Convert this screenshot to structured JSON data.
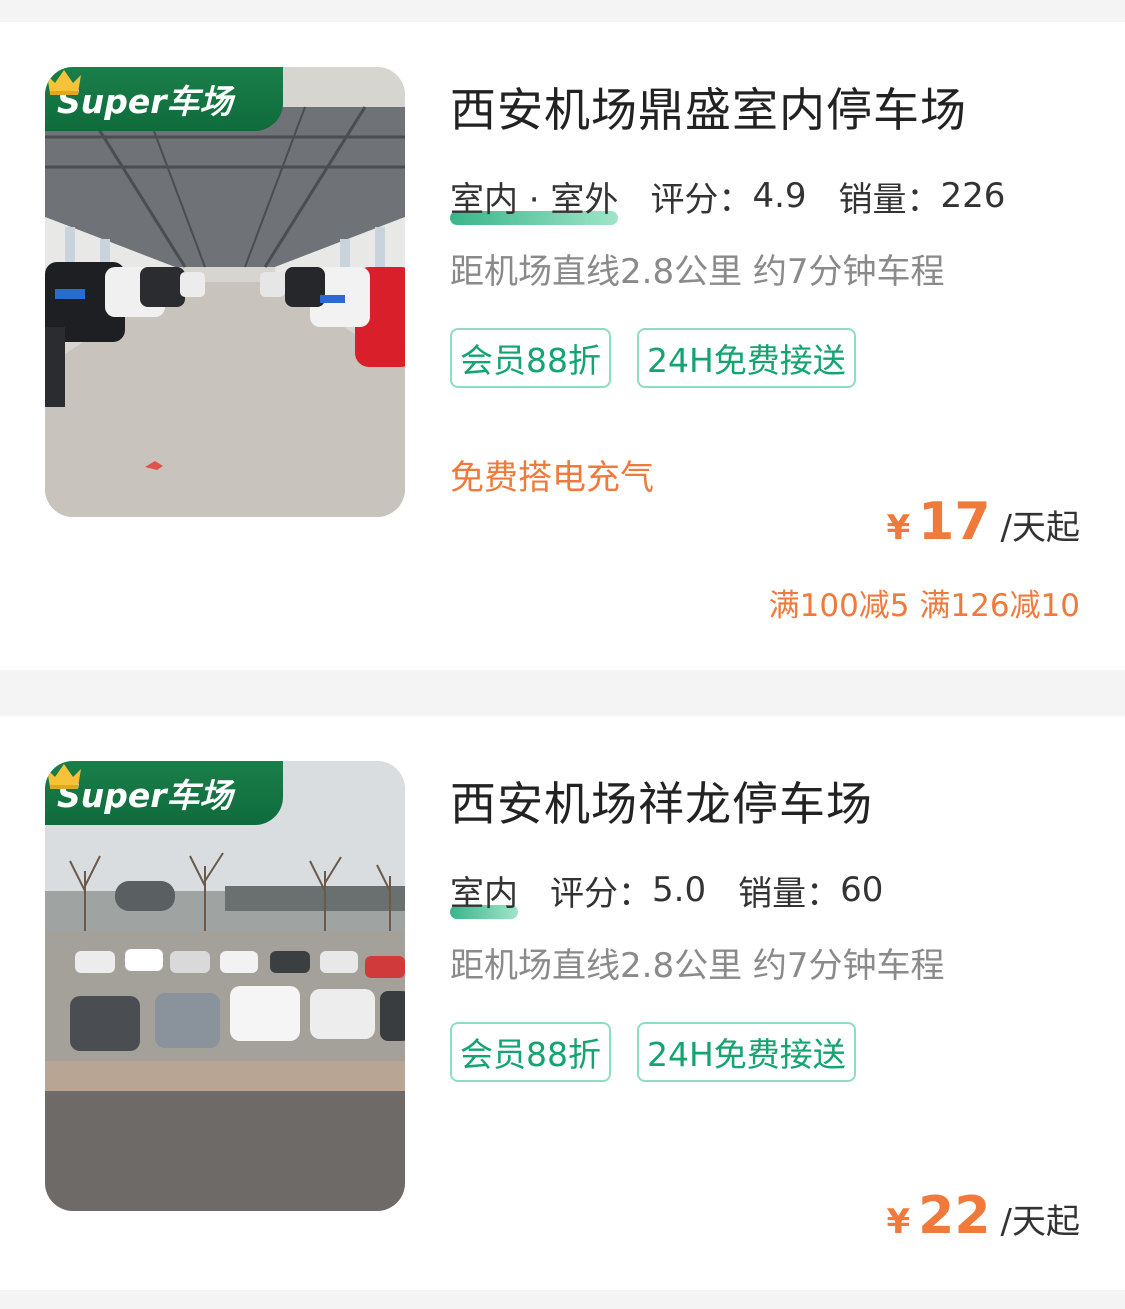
{
  "badge_label": "Super车场",
  "colors": {
    "brand_green": "#0f6b3c",
    "tag_green": "#13a472",
    "price_orange": "#f07a3c",
    "background": "#f4f4f4"
  },
  "listings": [
    {
      "title": "西安机场鼎盛室内停车场",
      "type": "室内 · 室外",
      "rating_label": "评分：",
      "rating": "4.9",
      "sales_label": "销量：",
      "sales": "226",
      "distance": "距机场直线2.8公里 约7分钟车程",
      "tags": [
        "会员88折",
        "24H免费接送"
      ],
      "service": "免费搭电充气",
      "price_currency": "¥",
      "price": "17",
      "price_unit": "/天起",
      "promo": "满100减5 满126减10",
      "image": "indoor-garage-photo"
    },
    {
      "title": "西安机场祥龙停车场",
      "type": "室内",
      "rating_label": "评分：",
      "rating": "5.0",
      "sales_label": "销量：",
      "sales": "60",
      "distance": "距机场直线2.8公里 约7分钟车程",
      "tags": [
        "会员88折",
        "24H免费接送"
      ],
      "price_currency": "¥",
      "price": "22",
      "price_unit": "/天起",
      "image": "outdoor-lot-photo"
    }
  ]
}
